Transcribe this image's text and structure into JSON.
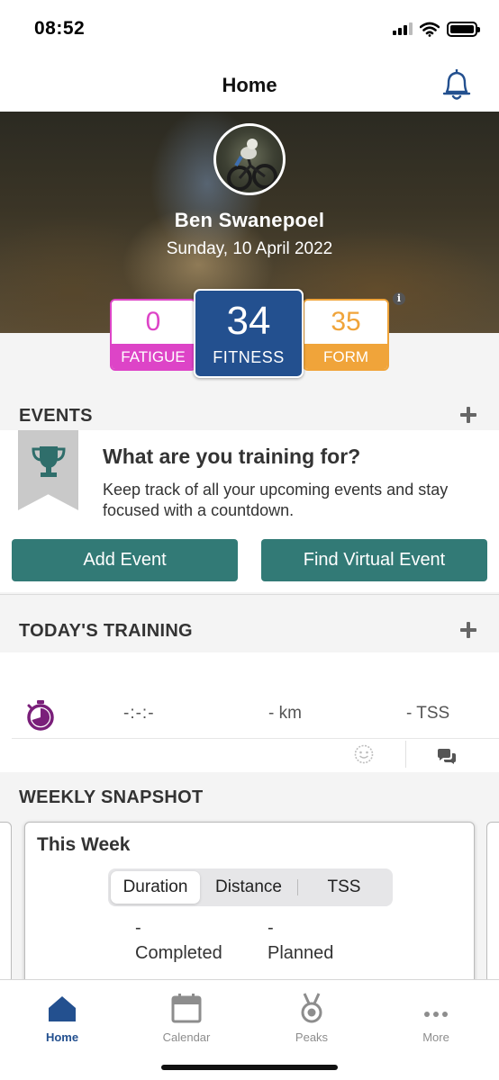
{
  "status_bar": {
    "time": "08:52"
  },
  "nav": {
    "title": "Home"
  },
  "profile": {
    "name": "Ben  Swanepoel",
    "date": "Sunday, 10 April 2022"
  },
  "metrics": {
    "fatigue": {
      "value": "0",
      "label": "FATIGUE",
      "color": "#dd44c7"
    },
    "fitness": {
      "value": "34",
      "label": "FITNESS",
      "color": "#23508f"
    },
    "form": {
      "value": "35",
      "label": "FORM",
      "color": "#f0a43a"
    }
  },
  "events": {
    "header": "EVENTS",
    "title": "What are you training for?",
    "description": "Keep track of all your upcoming events and stay focused with a countdown.",
    "add_button": "Add Event",
    "virtual_button": "Find Virtual Event",
    "button_color": "#327a76"
  },
  "training": {
    "header": "TODAY'S TRAINING",
    "duration": "-:-:-",
    "distance": "- km",
    "tss": "- TSS"
  },
  "snapshot": {
    "header": "WEEKLY SNAPSHOT",
    "card_title": "This Week",
    "tabs": [
      "Duration",
      "Distance",
      "TSS"
    ],
    "selected_tab": "Duration",
    "completed_value": "-",
    "completed_label": "Completed",
    "planned_value": "-",
    "planned_label": "Planned"
  },
  "tab_bar": {
    "items": [
      {
        "label": "Home",
        "icon": "home-icon",
        "active": true
      },
      {
        "label": "Calendar",
        "icon": "calendar-icon",
        "active": false
      },
      {
        "label": "Peaks",
        "icon": "medal-icon",
        "active": false
      },
      {
        "label": "More",
        "icon": "more-icon",
        "active": false
      }
    ]
  }
}
